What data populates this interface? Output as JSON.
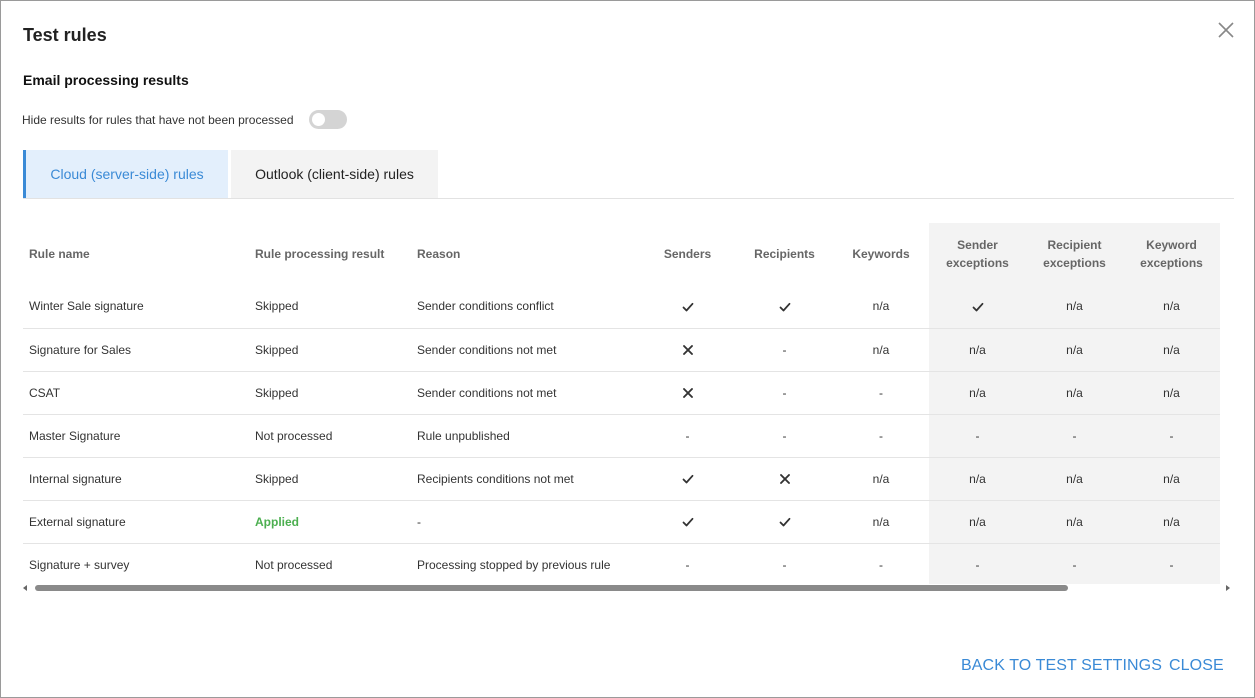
{
  "dialog": {
    "title": "Test rules",
    "subtitle": "Email processing results",
    "toggle_label": "Hide results for rules that have not been processed"
  },
  "tabs": [
    {
      "label": "Cloud (server-side) rules",
      "active": true
    },
    {
      "label": "Outlook (client-side) rules",
      "active": false
    }
  ],
  "table": {
    "columns": {
      "rule_name": "Rule name",
      "result": "Rule processing result",
      "reason": "Reason",
      "senders": "Senders",
      "recipients": "Recipients",
      "keywords": "Keywords",
      "sender_exceptions_1": "Sender",
      "sender_exceptions_2": "exceptions",
      "recipient_exceptions_1": "Recipient",
      "recipient_exceptions_2": "exceptions",
      "keyword_exceptions_1": "Keyword",
      "keyword_exceptions_2": "exceptions"
    },
    "rows": [
      {
        "name": "Winter Sale signature",
        "result": "Skipped",
        "reason": "Sender conditions conflict",
        "senders": "check",
        "recipients": "check",
        "keywords": "n/a",
        "sender_exc": "check",
        "recipient_exc": "n/a",
        "keyword_exc": "n/a"
      },
      {
        "name": "Signature for Sales",
        "result": "Skipped",
        "reason": "Sender conditions not met",
        "senders": "cross",
        "recipients": "-",
        "keywords": "n/a",
        "sender_exc": "n/a",
        "recipient_exc": "n/a",
        "keyword_exc": "n/a"
      },
      {
        "name": "CSAT",
        "result": "Skipped",
        "reason": "Sender conditions not met",
        "senders": "cross",
        "recipients": "-",
        "keywords": "-",
        "sender_exc": "n/a",
        "recipient_exc": "n/a",
        "keyword_exc": "n/a"
      },
      {
        "name": "Master Signature",
        "result": "Not processed",
        "reason": "Rule unpublished",
        "senders": "-",
        "recipients": "-",
        "keywords": "-",
        "sender_exc": "-",
        "recipient_exc": "-",
        "keyword_exc": "-"
      },
      {
        "name": "Internal signature",
        "result": "Skipped",
        "reason": "Recipients conditions not met",
        "senders": "check",
        "recipients": "cross",
        "keywords": "n/a",
        "sender_exc": "n/a",
        "recipient_exc": "n/a",
        "keyword_exc": "n/a"
      },
      {
        "name": "External signature",
        "result": "Applied",
        "reason": "-",
        "senders": "check",
        "recipients": "check",
        "keywords": "n/a",
        "sender_exc": "n/a",
        "recipient_exc": "n/a",
        "keyword_exc": "n/a"
      },
      {
        "name": "Signature + survey",
        "result": "Not processed",
        "reason": "Processing stopped by previous rule",
        "senders": "-",
        "recipients": "-",
        "keywords": "-",
        "sender_exc": "-",
        "recipient_exc": "-",
        "keyword_exc": "-"
      }
    ]
  },
  "footer": {
    "back_label": "BACK TO TEST SETTINGS",
    "close_label": "CLOSE"
  },
  "colors": {
    "accent": "#3a8ad6",
    "applied": "#4caf50",
    "exceptions_bg": "#f3f3f3"
  },
  "icons": {
    "check": "check-icon",
    "cross": "cross-icon",
    "close": "close-icon"
  }
}
